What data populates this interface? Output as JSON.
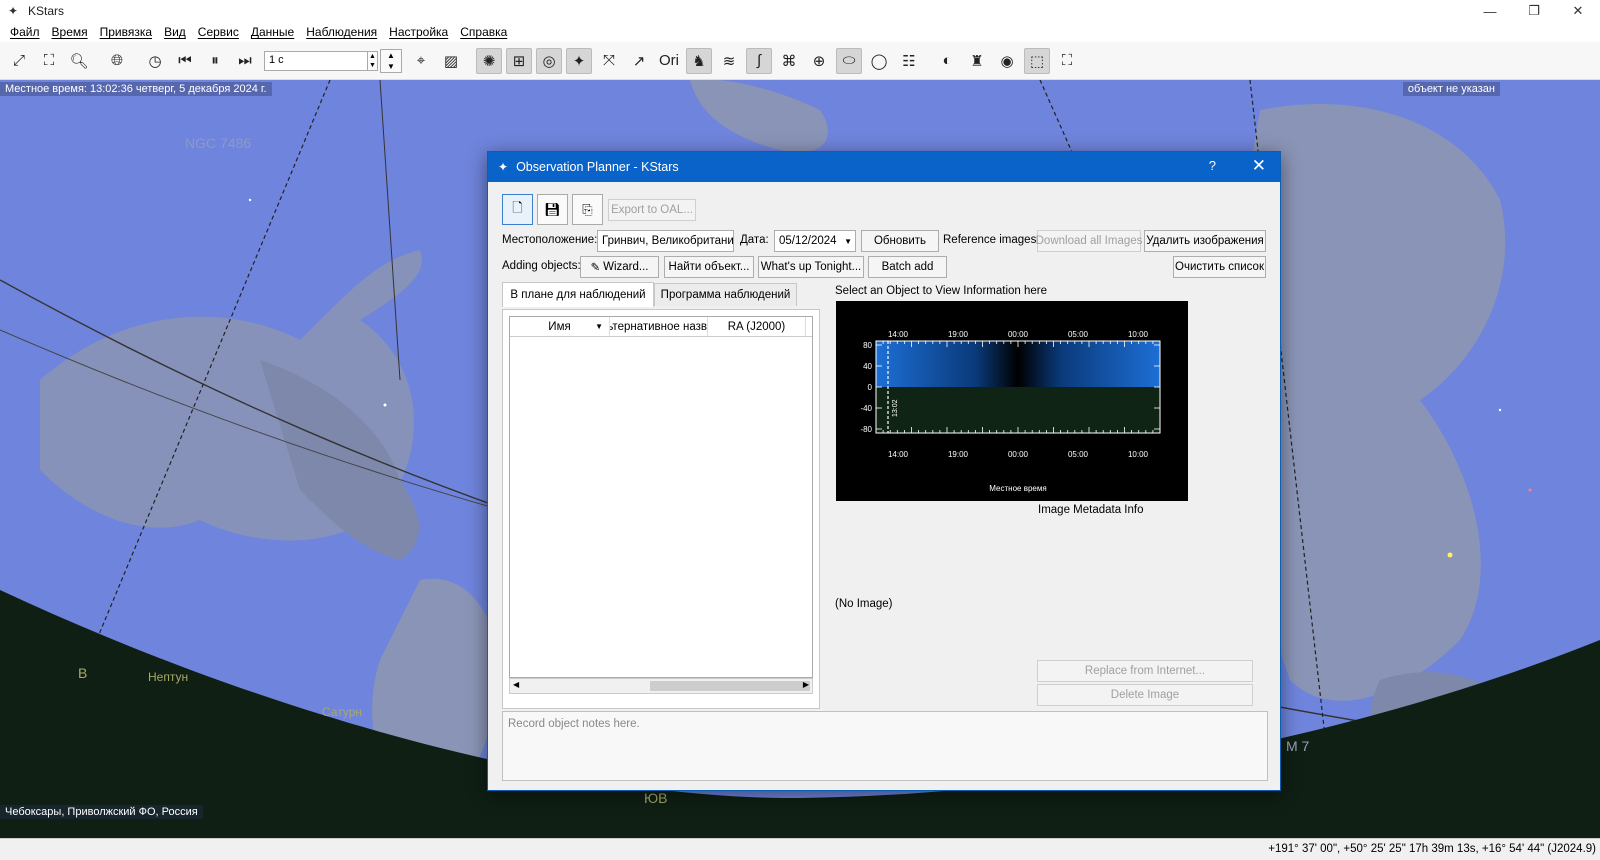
{
  "window": {
    "title": "KStars",
    "controls": {
      "minimize": "—",
      "maximize": "❐",
      "close": "✕"
    }
  },
  "menu": [
    "Файл",
    "Время",
    "Привязка",
    "Вид",
    "Сервис",
    "Данные",
    "Наблюдения",
    "Настройка",
    "Справка"
  ],
  "toolbar": {
    "timestep_value": "1 с"
  },
  "sky": {
    "local_time": "Местное время: 13:02:36   четверг, 5 декабря 2024 г.",
    "focus_object": "объект не указан",
    "location": "Чебоксары, Приволжский ФО, Россия",
    "labels": {
      "ngc": "NGC 7486",
      "east": "В",
      "neptune": "Нептун",
      "saturn": "Сатурн",
      "south_east": "ЮВ",
      "m7": "M 7"
    },
    "colors": {
      "sky": "#6f84dc",
      "ground": "#0f1f14",
      "constellation_art": "#8893b5"
    }
  },
  "statusbar": {
    "coords": "+191° 37' 00\", +50° 25' 25\"  17h 39m 13s, +16° 54' 44\" (J2024.9)"
  },
  "dialog": {
    "title": "Observation Planner - KStars",
    "help": "?",
    "close": "✕",
    "export_oal": "Export to OAL...",
    "location_label": "Местоположение:",
    "location_value": "Гринвич, Великобритания",
    "date_label": "Дата:",
    "date_value": "05/12/2024",
    "update_button": "Обновить",
    "reference_images_label": "Reference images:",
    "download_all_images": "Download all Images",
    "delete_images": "Удалить изображения",
    "adding_objects_label": "Adding objects:",
    "wizard": "Wizard...",
    "find_object": "Найти объект...",
    "whats_up": "What's up Tonight...",
    "batch_add": "Batch add",
    "clear_list": "Очистить список",
    "tabs": [
      "В плане для наблюдений",
      "Программа наблюдений"
    ],
    "columns": [
      "Имя",
      "Альтернативное назв",
      "RA (J2000)"
    ],
    "select_object_hint": "Select an Object to View Information here",
    "image_metadata": "Image Metadata Info",
    "no_image": "(No Image)",
    "replace_from_internet": "Replace from Internet...",
    "delete_image": "Delete Image",
    "notes_placeholder": "Record object notes here."
  },
  "altitude_chart": {
    "top_ticks": [
      "14:00",
      "19:00",
      "00:00",
      "05:00",
      "10:00"
    ],
    "bottom_ticks": [
      "14:00",
      "19:00",
      "00:00",
      "05:00",
      "10:00"
    ],
    "y_ticks": [
      "80",
      "40",
      "0",
      "-40",
      "-80"
    ],
    "current_time": "13:02",
    "xlabel": "Местное время"
  }
}
